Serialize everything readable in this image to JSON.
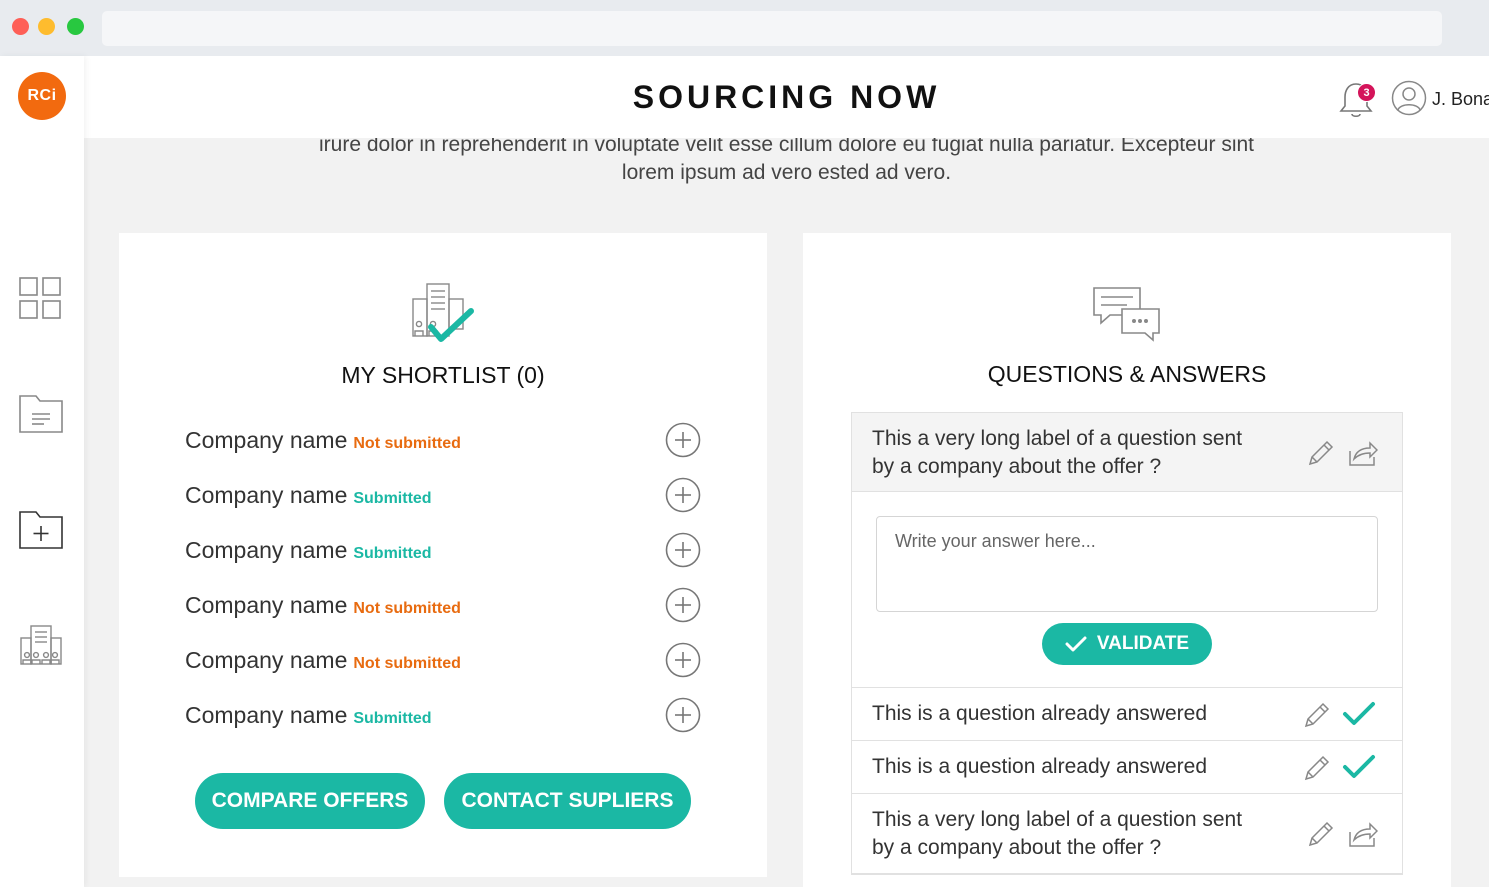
{
  "header": {
    "title": "SOURCING NOW",
    "notification_count": "3",
    "user_name": "J. Bona"
  },
  "intro": {
    "line1": "irure dolor in reprehenderit in voluptate velit esse cillum dolore eu fugiat nulla pariatur. Excepteur sint",
    "line2": "lorem ipsum ad vero ested ad vero."
  },
  "sidebar": {
    "logo_text": "RCi",
    "items": [
      {
        "icon": "dashboard-grid-icon"
      },
      {
        "icon": "document-folder-icon"
      },
      {
        "icon": "new-folder-icon"
      },
      {
        "icon": "companies-building-icon"
      }
    ]
  },
  "shortlist": {
    "title": "MY SHORTLIST (0)",
    "items": [
      {
        "name": "Company name",
        "status": "Not submitted"
      },
      {
        "name": "Company name",
        "status": "Submitted"
      },
      {
        "name": "Company name",
        "status": "Submitted"
      },
      {
        "name": "Company name",
        "status": "Not submitted"
      },
      {
        "name": "Company name",
        "status": "Not submitted"
      },
      {
        "name": "Company name",
        "status": "Submitted"
      }
    ],
    "compare_label": "COMPARE OFFERS",
    "contact_label": "CONTACT SUPLIERS"
  },
  "qa": {
    "title": "QUESTIONS & ANSWERS",
    "active_question_line1": "This a very long label of a question sent",
    "active_question_line2": "by a company about the offer ?",
    "answer_placeholder": "Write your answer here...",
    "validate_label": "VALIDATE",
    "answered": [
      {
        "text": "This is a question already answered"
      },
      {
        "text": "This is a question already answered"
      }
    ],
    "last_question_line1": "This a very long label of a question sent",
    "last_question_line2": "by a company about the offer ?"
  },
  "colors": {
    "accent": "#1bb8a4",
    "not_submitted": "#e86b10",
    "logo": "#f26a0f",
    "badge": "#d4145a"
  }
}
